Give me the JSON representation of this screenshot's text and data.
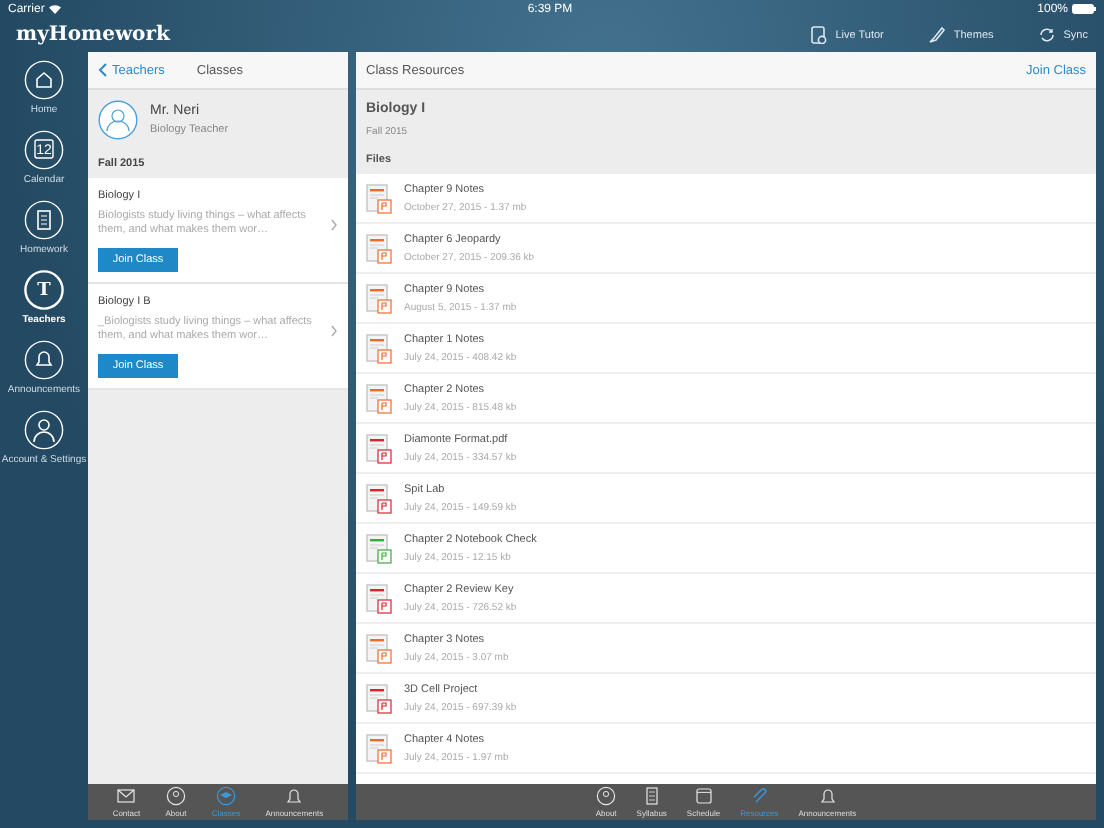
{
  "status_bar": {
    "carrier": "Carrier",
    "time": "6:39 PM",
    "battery": "100%"
  },
  "app_title": "myHomework",
  "header_actions": [
    {
      "kind": "tutor",
      "label": "Live Tutor"
    },
    {
      "kind": "themes",
      "label": "Themes"
    },
    {
      "kind": "sync",
      "label": "Sync"
    }
  ],
  "sidebar": {
    "items": [
      {
        "kind": "home",
        "label": "Home",
        "selected": false
      },
      {
        "kind": "calendar",
        "label": "Calendar",
        "day": "12",
        "selected": false
      },
      {
        "kind": "homework",
        "label": "Homework",
        "selected": false
      },
      {
        "kind": "teachers",
        "label": "Teachers",
        "glyph": "T",
        "selected": true
      },
      {
        "kind": "announcements",
        "label": "Announcements",
        "selected": false
      },
      {
        "kind": "account",
        "label": "Account & Settings",
        "selected": false
      }
    ]
  },
  "classes_panel": {
    "back": "Teachers",
    "title": "Classes",
    "teacher": {
      "name": "Mr. Neri",
      "role": "Biology Teacher"
    },
    "term": "Fall 2015",
    "classes": [
      {
        "name": "Biology I",
        "description": "Biologists study living things – what affects them, and what makes them wor…",
        "button": "Join Class"
      },
      {
        "name": "Biology I B",
        "description": "_Biologists study living things – what affects them, and what makes them wor…",
        "button": "Join Class"
      }
    ],
    "tabs": [
      {
        "kind": "contact",
        "label": "Contact",
        "selected": false
      },
      {
        "kind": "about",
        "label": "About",
        "selected": false
      },
      {
        "kind": "classes",
        "label": "Classes",
        "selected": true
      },
      {
        "kind": "announcements",
        "label": "Announcements",
        "selected": false
      }
    ]
  },
  "resources_panel": {
    "title": "Class Resources",
    "action": "Join Class",
    "class_name": "Biology I",
    "term": "Fall 2015",
    "files_label": "Files",
    "files": [
      {
        "kind": "ppt",
        "name": "Chapter 9 Notes",
        "meta": "October 27, 2015 - 1.37 mb"
      },
      {
        "kind": "ppt",
        "name": "Chapter 6 Jeopardy",
        "meta": "October 27, 2015 - 209.36 kb"
      },
      {
        "kind": "ppt",
        "name": "Chapter 9 Notes",
        "meta": "August 5, 2015 - 1.37 mb"
      },
      {
        "kind": "ppt",
        "name": "Chapter 1 Notes",
        "meta": "July 24, 2015 - 408.42 kb"
      },
      {
        "kind": "ppt",
        "name": "Chapter 2 Notes",
        "meta": "July 24, 2015 - 815.48 kb"
      },
      {
        "kind": "pdf",
        "name": "Diamonte Format.pdf",
        "meta": "July 24, 2015 - 334.57 kb"
      },
      {
        "kind": "pdf",
        "name": "Spit Lab",
        "meta": "July 24, 2015 - 149.59 kb"
      },
      {
        "kind": "xls",
        "name": "Chapter 2 Notebook Check",
        "meta": "July 24, 2015 - 12.15 kb"
      },
      {
        "kind": "pdf",
        "name": "Chapter 2 Review Key",
        "meta": "July 24, 2015 - 726.52 kb"
      },
      {
        "kind": "ppt",
        "name": "Chapter 3 Notes",
        "meta": "July 24, 2015 - 3.07 mb"
      },
      {
        "kind": "pdf",
        "name": "3D Cell Project",
        "meta": "July 24, 2015 - 697.39 kb"
      },
      {
        "kind": "ppt",
        "name": "Chapter 4 Notes",
        "meta": "July 24, 2015 - 1.97 mb"
      }
    ],
    "tabs": [
      {
        "kind": "about",
        "label": "About",
        "selected": false
      },
      {
        "kind": "syllabus",
        "label": "Syllabus",
        "selected": false
      },
      {
        "kind": "schedule",
        "label": "Schedule",
        "selected": false
      },
      {
        "kind": "resources",
        "label": "Resources",
        "selected": true
      },
      {
        "kind": "announcements",
        "label": "Announcements",
        "selected": false
      }
    ]
  }
}
